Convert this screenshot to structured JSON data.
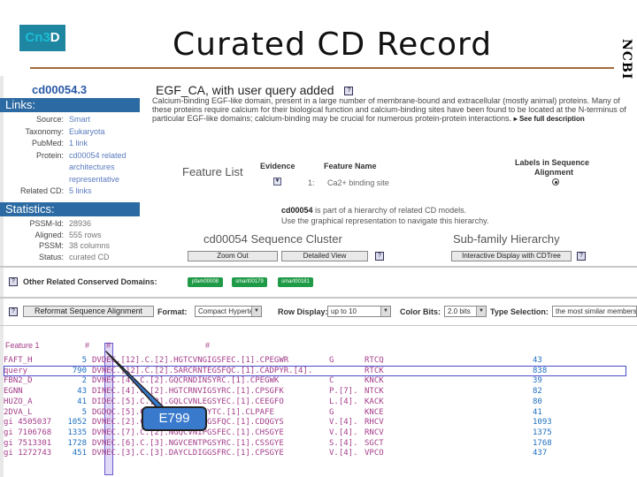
{
  "slide": {
    "logo_a": "Cn3",
    "logo_b": "D",
    "title": "Curated CD Record",
    "ncbi": "NCBI"
  },
  "left": {
    "cd_id": "cd00054.3",
    "links_header": "Links:",
    "links": [
      {
        "k": "Source:",
        "v": "Smart"
      },
      {
        "k": "Taxonomy:",
        "v": "Eukaryota"
      },
      {
        "k": "PubMed:",
        "v": "1 link"
      },
      {
        "k": "Protein:",
        "v": "cd00054 related"
      },
      {
        "k": "",
        "v": "architectures"
      },
      {
        "k": "",
        "v": "representative"
      },
      {
        "k": "Related CD:",
        "v": "5 links"
      }
    ],
    "stats_header": "Statistics:",
    "stats": [
      {
        "k": "PSSM-Id:",
        "v": "28936"
      },
      {
        "k": "Aligned:",
        "v": "555 rows"
      },
      {
        "k": "PSSM:",
        "v": "38 columns"
      },
      {
        "k": "Status:",
        "v": "curated CD"
      }
    ]
  },
  "main": {
    "cd_title": "EGF_CA, with user query added",
    "help": "?",
    "description": "Calcium-binding EGF-like domain, present in a large number of membrane-bound and extracellular (mostly animal) proteins. Many of these proteins require calcium for their biological function and calcium-binding sites have been found to be located at the N-terminus of particular EGF-like domains; calcium-binding may be crucial for numerous protein-protein interactions.",
    "see_full": "▸ See full description",
    "feature_list": "Feature List",
    "evidence_header": "Evidence",
    "feature_name_header": "Feature Name",
    "labels_header": "Labels in Sequence",
    "alignment_header": "Alignment",
    "feature_index": "1:",
    "feature_name": "Ca2+ binding site",
    "hier_line1_bold": "cd00054",
    "hier_line1": " is part of a hierarchy of related CD models.",
    "hier_line2": "Use the graphical representation to navigate this hierarchy.",
    "cluster_title": "cd00054 Sequence Cluster",
    "subfamily_title": "Sub-family Hierarchy",
    "zoom_out": "Zoom Out",
    "detailed_view": "Detailed View",
    "interactive": "Interactive Display with CDTree"
  },
  "other_domains": {
    "label": "Other Related Conserved Domains:",
    "pills": [
      "pfam00008",
      "smart00179",
      "smart00181"
    ]
  },
  "format_row": {
    "reformat": "Reformat Sequence Alignment",
    "format_label": "Format:",
    "format_value": "Compact Hypertext",
    "row_display_label": "Row Display:",
    "row_display_value": "up to 10",
    "color_bits_label": "Color Bits:",
    "color_bits_value": "2.0 bits",
    "type_label": "Type Selection:",
    "type_value": "the most similar members"
  },
  "alignment": {
    "head_feature": "Feature 1",
    "head_hash1": "#",
    "head_hash2": "#",
    "head_hash3": "#",
    "rows": [
      {
        "name": "FAFT_H",
        "num": "5",
        "seq": "DVDEC.[12].C.[2].HGTCVNGIGSFEC.[1].CPEGWR",
        "tail": "G",
        "tail2": "RTCQ",
        "end": "43"
      },
      {
        "name": "query",
        "num": "790",
        "seq": "DVNEC.[12].C.[2].SARCRNTEGSFQC.[1].CADPYR.[4].",
        "tail": "",
        "tail2": "RTCK",
        "end": "838"
      },
      {
        "name": "FBN2_D",
        "num": "2",
        "seq": "DVNEC.[4].C.[2].GQCRNDINSYRC.[1].CPEGWK",
        "tail": "C",
        "tail2": "KNCK",
        "end": "39"
      },
      {
        "name": "EGNN",
        "num": "43",
        "seq": "DINEC.[4].C.[2].HGTCRNVIGSYRC.[1].CPSGFK",
        "tail": "P.[7].",
        "tail2": "NTCK",
        "end": "82"
      },
      {
        "name": "HUZO_A",
        "num": "41",
        "seq": "DIDEC.[5].C.[2].GQLCVNLEGSYEC.[1].CEEGFO",
        "tail": "L.[4].",
        "tail2": "KACK",
        "end": "80"
      },
      {
        "name": "2DVA_L",
        "num": "5",
        "seq": "DGDQC.[5].C.[2].GTCKDOISYTC.[1].CLPAFE",
        "tail": "G",
        "tail2": "KNCE",
        "end": "41"
      },
      {
        "name": "gi 4505037",
        "num": "1052",
        "seq": "DVNEC.[2].C.[3].HGTCHNLPGSFQC.[1].CDQGYS",
        "tail": "V.[4].",
        "tail2": "RHCV",
        "end": "1093"
      },
      {
        "name": "gi 7106768",
        "num": "1335",
        "seq": "DVNEC.[7].C.[2].NGQCVNIPGSFEC.[1].CHSGYE",
        "tail": "V.[4].",
        "tail2": "RNCV",
        "end": "1375"
      },
      {
        "name": "gi 7513301",
        "num": "1728",
        "seq": "DVNEC.[6].C.[3].NGVCENTPGSYRC.[1].CSSGYE",
        "tail": "S.[4].",
        "tail2": "SGCT",
        "end": "1768"
      },
      {
        "name": "gi 1272743",
        "num": "451",
        "seq": "DVNEC.[3].C.[3].DAYCLDIGGSFRC.[1].CPSGYE",
        "tail": "V.[4].",
        "tail2": "VPCO",
        "end": "437"
      }
    ]
  },
  "callout": {
    "label": "E799"
  },
  "colors": {
    "bar_blue": "#2c6aa3",
    "link_blue": "#5a7bbf",
    "seq_magenta": "#a43c8a",
    "num_blue": "#1e6fbf",
    "pill_green": "#1f9a46",
    "highlight": "#6a5acd"
  }
}
